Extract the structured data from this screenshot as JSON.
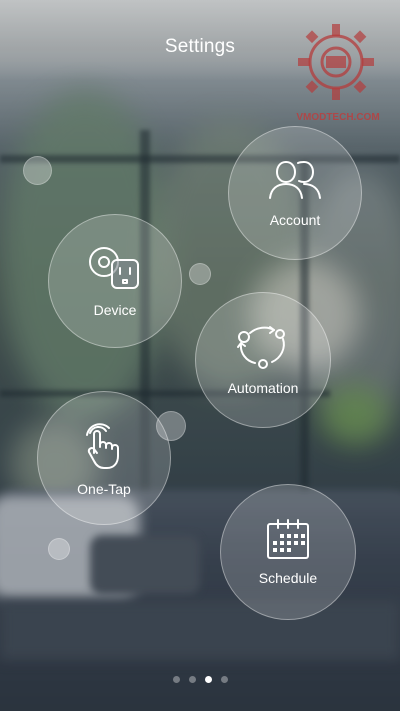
{
  "header": {
    "title": "Settings"
  },
  "watermark": {
    "text": "VMODTECH.COM"
  },
  "menu": {
    "account": {
      "label": "Account",
      "icon": "users-icon"
    },
    "device": {
      "label": "Device",
      "icon": "smart-plug-icon"
    },
    "automation": {
      "label": "Automation",
      "icon": "cycle-icon"
    },
    "one_tap": {
      "label": "One-Tap",
      "icon": "tap-hand-icon"
    },
    "schedule": {
      "label": "Schedule",
      "icon": "calendar-icon"
    }
  },
  "pager": {
    "total": 4,
    "active_index": 2
  }
}
